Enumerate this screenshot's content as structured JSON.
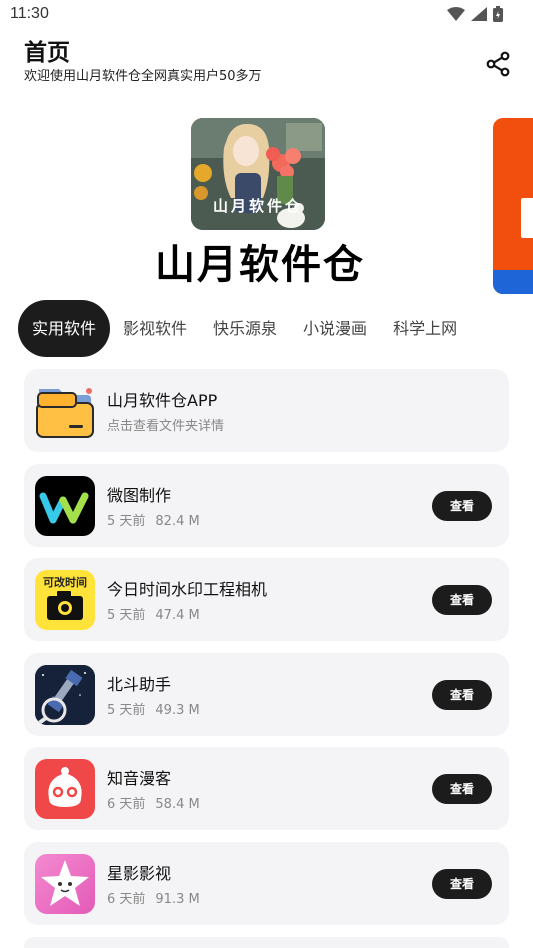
{
  "status": {
    "time": "11:30"
  },
  "header": {
    "title": "首页",
    "subtitle": "欢迎使用山月软件仓全网真实用户50多万"
  },
  "banner": {
    "logo_text": "山月软件仓",
    "thumb_text": "山月软件仓"
  },
  "tabs": [
    {
      "label": "实用软件",
      "active": true
    },
    {
      "label": "影视软件"
    },
    {
      "label": "快乐源泉"
    },
    {
      "label": "小说漫画"
    },
    {
      "label": "科学上网"
    }
  ],
  "folder_card": {
    "name": "山月软件仓APP",
    "desc": "点击查看文件夹详情"
  },
  "apps": [
    {
      "name": "微图制作",
      "time": "5 天前",
      "size": "82.4 M",
      "action": "查看",
      "icon": "weitu-icon"
    },
    {
      "name": "今日时间水印工程相机",
      "time": "5 天前",
      "size": "47.4 M",
      "action": "查看",
      "icon": "camera-icon",
      "icon_text": "可改时间"
    },
    {
      "name": "北斗助手",
      "time": "5 天前",
      "size": "49.3 M",
      "action": "查看",
      "icon": "satellite-icon"
    },
    {
      "name": "知音漫客",
      "time": "6 天前",
      "size": "58.4 M",
      "action": "查看",
      "icon": "zhiyin-icon"
    },
    {
      "name": "星影影视",
      "time": "6 天前",
      "size": "91.3 M",
      "action": "查看",
      "icon": "star-icon"
    }
  ],
  "colors": {
    "accent": "#1c1c1c",
    "card_bg": "#f4f4f6",
    "banner_peek": "#f24e0d"
  }
}
